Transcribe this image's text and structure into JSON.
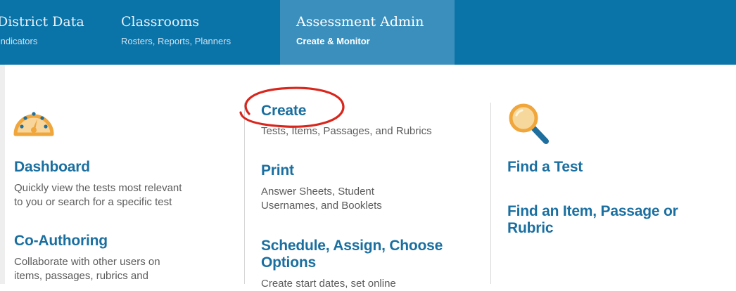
{
  "nav": {
    "tabs": [
      {
        "title": "District Data",
        "subtitle": "Indicators"
      },
      {
        "title": "Classrooms",
        "subtitle": "Rosters, Reports, Planners"
      },
      {
        "title": "Assessment Admin",
        "subtitle": "Create & Monitor"
      }
    ]
  },
  "menu": {
    "col1": [
      {
        "icon": "speedometer-icon",
        "heading": "Dashboard",
        "lines": [
          "Quickly view the tests most relevant",
          "to you or search for a specific test"
        ]
      },
      {
        "heading": "Co-Authoring",
        "lines": [
          "Collaborate with other users on",
          "items, passages, rubrics and"
        ]
      }
    ],
    "col2": [
      {
        "heading": "Create",
        "lines": [
          "Tests, Items, Passages, and Rubrics"
        ],
        "annotation": "red-circle-highlight"
      },
      {
        "heading": "Print",
        "lines": [
          "Answer Sheets, Student",
          "Usernames, and Booklets"
        ]
      },
      {
        "heading_lines": [
          "Schedule, Assign, Choose",
          "Options"
        ],
        "lines": [
          "Create start dates, set online"
        ]
      }
    ],
    "col3": [
      {
        "icon": "magnifier-icon",
        "heading": "Find a Test"
      },
      {
        "heading_lines": [
          "Find an Item, Passage or",
          "Rubric"
        ]
      }
    ]
  },
  "colors": {
    "nav_bg": "#0a73a8",
    "nav_active": "#3b8fbd",
    "heading": "#1a6fa0",
    "desc": "#5c5c5c",
    "icon_orange": "#f0a63a",
    "annotation_red": "#d9261c"
  }
}
